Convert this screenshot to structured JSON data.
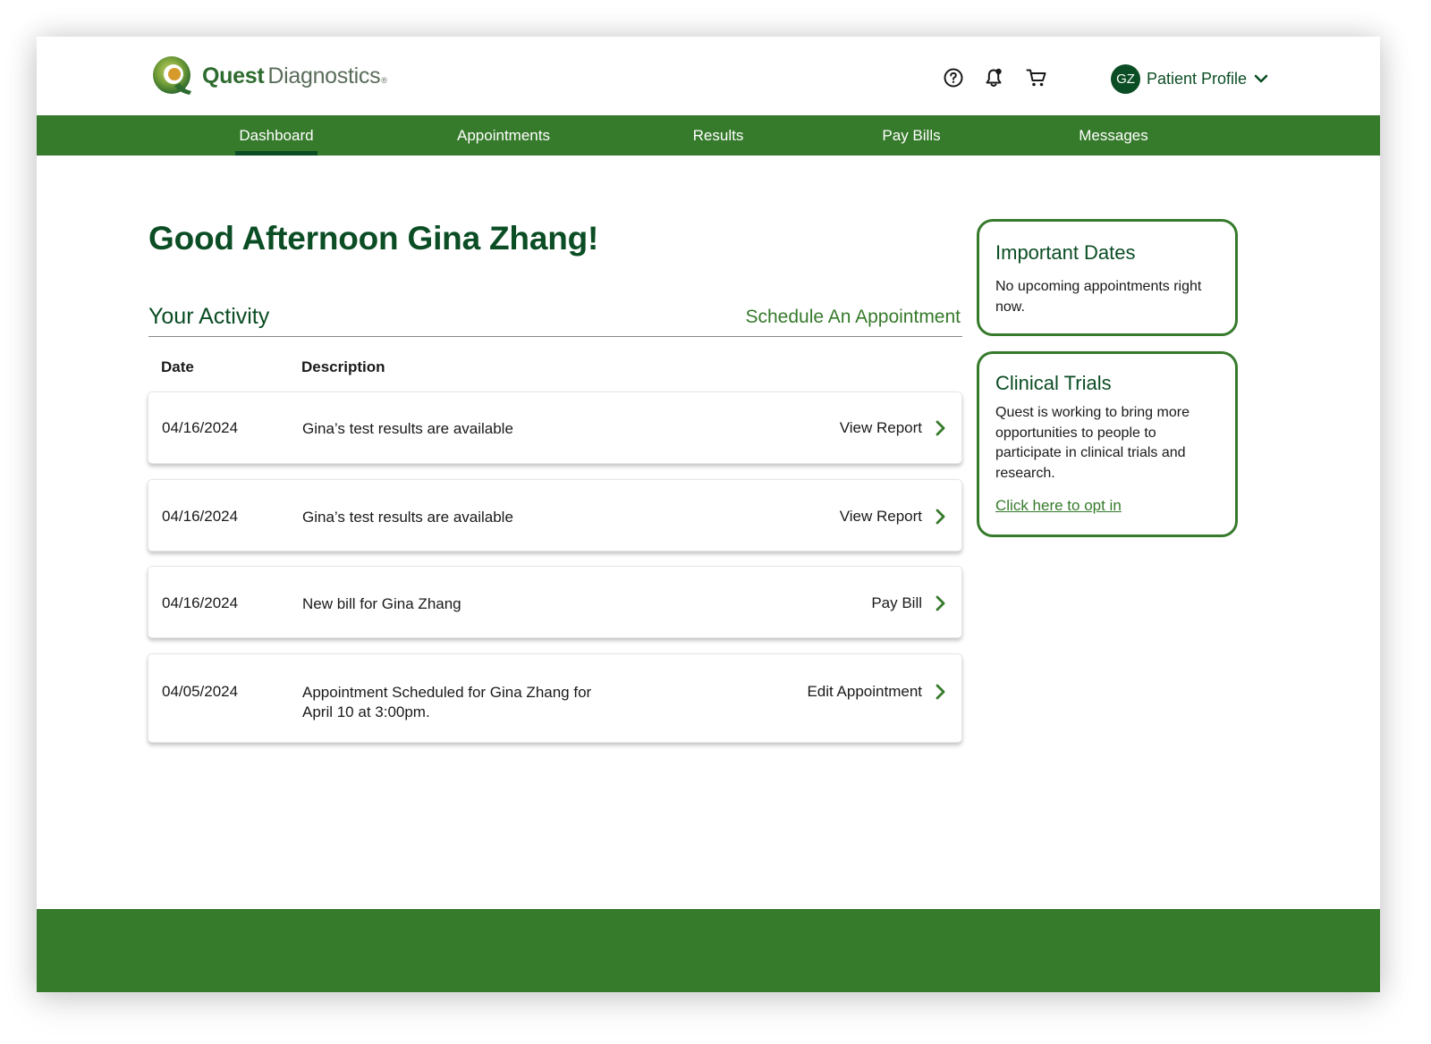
{
  "brand": {
    "name_bold": "Quest",
    "name_light": "Diagnostics",
    "registered": "®",
    "colors": {
      "primary": "#367a2b",
      "dark": "#0b4d24"
    }
  },
  "header": {
    "icons": [
      "help-icon",
      "notification-bell-icon",
      "cart-icon"
    ],
    "profile": {
      "initials": "GZ",
      "label": "Patient Profile"
    }
  },
  "nav": {
    "items": [
      "Dashboard",
      "Appointments",
      "Results",
      "Pay Bills",
      "Messages"
    ],
    "active": "Dashboard"
  },
  "main": {
    "greeting": "Good Afternoon Gina Zhang!",
    "activity_title": "Your Activity",
    "schedule_link": "Schedule An Appointment",
    "columns": {
      "date": "Date",
      "description": "Description"
    },
    "rows": [
      {
        "date": "04/16/2024",
        "description": "Gina’s test results are available",
        "action": "View Report"
      },
      {
        "date": "04/16/2024",
        "description": "Gina’s test results are available",
        "action": "View Report"
      },
      {
        "date": "04/16/2024",
        "description": "New bill for Gina Zhang",
        "action": "Pay Bill"
      },
      {
        "date": "04/05/2024",
        "description": "Appointment Scheduled for Gina Zhang for April 10 at 3:00pm.",
        "action": "Edit Appointment"
      }
    ]
  },
  "sidebar": {
    "important_dates": {
      "title": "Important Dates",
      "body": "No upcoming appointments right now."
    },
    "clinical_trials": {
      "title": "Clinical Trials",
      "body": "Quest is working to bring more opportunities to people to participate in clinical trials and research.",
      "link": "Click here to opt in"
    }
  }
}
